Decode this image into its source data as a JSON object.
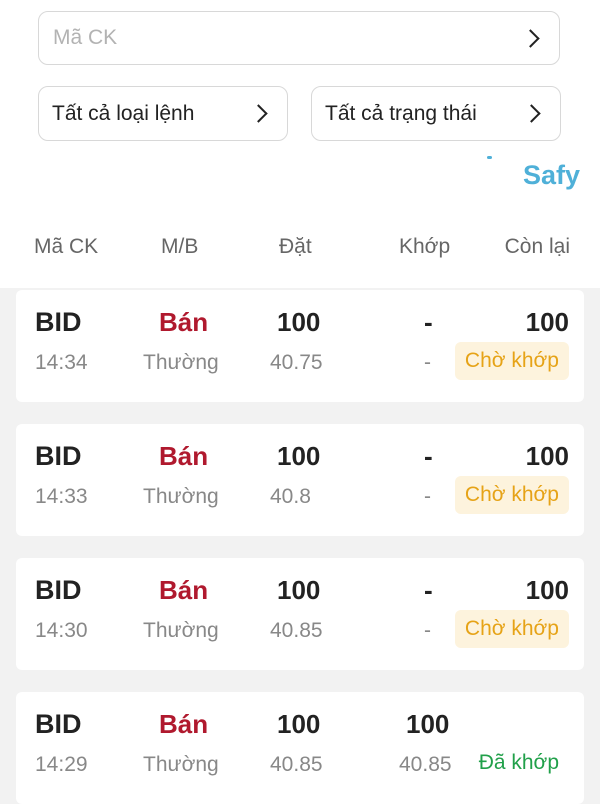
{
  "filters": {
    "symbol_placeholder": "Mã CK",
    "order_type_label": "Tất cả loại lệnh",
    "status_label": "Tất cả trạng thái"
  },
  "brand": {
    "name": "Safy",
    "color": "#4fb0d8"
  },
  "table": {
    "headers": {
      "symbol": "Mã CK",
      "side": "M/B",
      "placed": "Đặt",
      "matched": "Khớp",
      "remaining": "Còn lại"
    },
    "rows": [
      {
        "symbol": "BID",
        "time": "14:34",
        "side": "Bán",
        "order_type": "Thường",
        "qty": "100",
        "price": "40.75",
        "matched_qty": "-",
        "matched_price": "-",
        "remaining": "100",
        "status": "Chờ khớp",
        "status_kind": "pending"
      },
      {
        "symbol": "BID",
        "time": "14:33",
        "side": "Bán",
        "order_type": "Thường",
        "qty": "100",
        "price": "40.8",
        "matched_qty": "-",
        "matched_price": "-",
        "remaining": "100",
        "status": "Chờ khớp",
        "status_kind": "pending"
      },
      {
        "symbol": "BID",
        "time": "14:30",
        "side": "Bán",
        "order_type": "Thường",
        "qty": "100",
        "price": "40.85",
        "matched_qty": "-",
        "matched_price": "-",
        "remaining": "100",
        "status": "Chờ khớp",
        "status_kind": "pending"
      },
      {
        "symbol": "BID",
        "time": "14:29",
        "side": "Bán",
        "order_type": "Thường",
        "qty": "100",
        "price": "40.85",
        "matched_qty": "100",
        "matched_price": "40.85",
        "remaining": "",
        "status": "Đã khớp",
        "status_kind": "matched"
      }
    ]
  },
  "colors": {
    "sell": "#b0192e",
    "pending": "#e6a317",
    "pending_bg": "#fdf3dd",
    "matched": "#21a04a"
  }
}
